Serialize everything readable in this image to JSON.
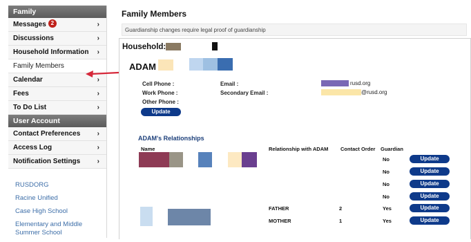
{
  "sidebar": {
    "family_header": "Family",
    "family_items": [
      {
        "label": "Messages",
        "badge": "2"
      },
      {
        "label": "Discussions"
      },
      {
        "label": "Household Information"
      },
      {
        "label": "Family Members"
      },
      {
        "label": "Calendar"
      },
      {
        "label": "Fees"
      },
      {
        "label": "To Do List"
      }
    ],
    "user_header": "User Account",
    "user_items": [
      {
        "label": "Contact Preferences"
      },
      {
        "label": "Access Log"
      },
      {
        "label": "Notification Settings"
      }
    ],
    "links": [
      "RUSDORG",
      "Racine Unified",
      "Case High School",
      "Elementary and Middle Summer School"
    ]
  },
  "main": {
    "title": "Family Members",
    "notice": "Guardianship changes require legal proof of guardianship",
    "household_label": "Household:",
    "member": {
      "name": "ADAM",
      "cell_phone_label": "Cell Phone :",
      "work_phone_label": "Work Phone :",
      "other_phone_label": "Other Phone :",
      "email_label": "Email :",
      "secondary_email_label": "Secondary Email :",
      "email_value_suffix": "rusd.org",
      "secondary_email_suffix": "@rusd.org",
      "update_label": "Update"
    },
    "relationships": {
      "title": "ADAM's Relationships",
      "col_name": "Name",
      "col_relationship": "Relationship with ADAM",
      "col_contact_order": "Contact Order",
      "col_guardian": "Guardian",
      "rows": [
        {
          "relationship": "",
          "contact_order": "",
          "guardian": "No"
        },
        {
          "relationship": "",
          "contact_order": "",
          "guardian": "No"
        },
        {
          "relationship": "",
          "contact_order": "",
          "guardian": "No"
        },
        {
          "relationship": "",
          "contact_order": "",
          "guardian": "No"
        },
        {
          "relationship": "FATHER",
          "contact_order": "2",
          "guardian": "Yes"
        },
        {
          "relationship": "MOTHER",
          "contact_order": "1",
          "guardian": "Yes"
        }
      ],
      "update_label": "Update"
    }
  },
  "colors": {
    "header_gray": "#666666",
    "button_blue": "#0e3a8a",
    "badge_red": "#c0211b",
    "pointer_red": "#d6283a",
    "link_blue": "#3d6ea8"
  }
}
